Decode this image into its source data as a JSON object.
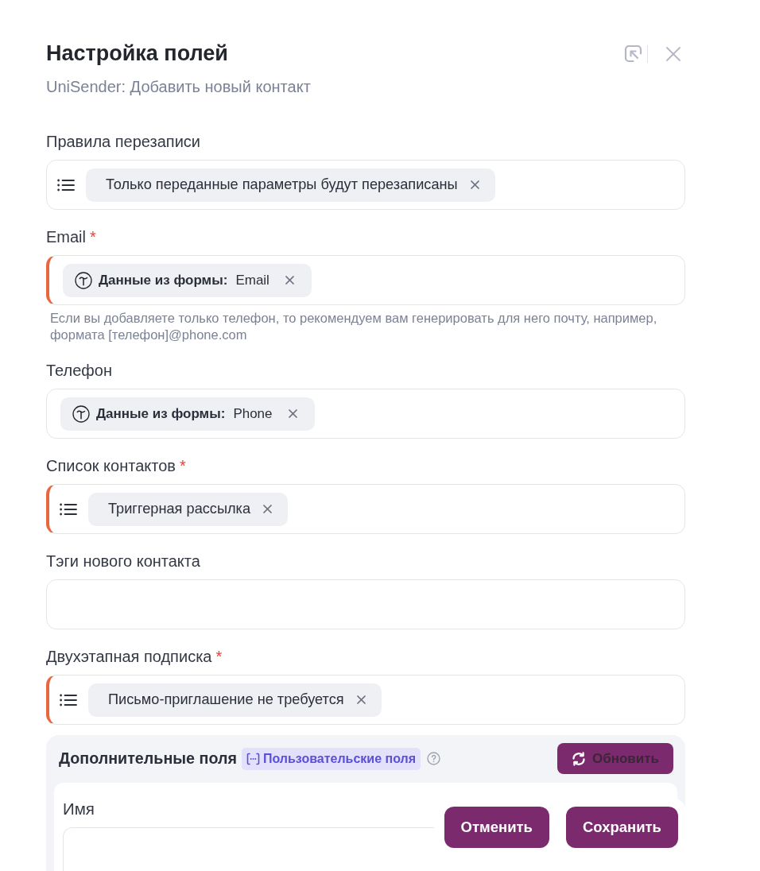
{
  "header": {
    "title": "Настройка полей",
    "subtitle": "UniSender: Добавить новый контакт"
  },
  "fields": [
    {
      "kind": "select",
      "label": "Правила перезаписи",
      "required": false,
      "chips": [
        {
          "text": "Только переданные параметры будут перезаписаны"
        }
      ]
    },
    {
      "kind": "mapping",
      "label": "Email",
      "required": true,
      "required_mark": "*",
      "chips": [
        {
          "source": "Данные из формы:",
          "value": "Email"
        }
      ],
      "hint": "Если вы добавляете только телефон, то рекомендуем вам генерировать для него почту, например, формата [телефон]@phone.com"
    },
    {
      "kind": "mapping",
      "label": "Телефон",
      "required": false,
      "chips": [
        {
          "source": "Данные из формы:",
          "value": "Phone"
        }
      ]
    },
    {
      "kind": "select",
      "label": "Список контактов",
      "required": true,
      "required_mark": "*",
      "chips": [
        {
          "text": "Триггерная рассылка"
        }
      ]
    },
    {
      "kind": "text",
      "label": "Тэги нового контакта",
      "required": false
    },
    {
      "kind": "select",
      "label": "Двухэтапная подписка",
      "required": true,
      "required_mark": "*",
      "chips": [
        {
          "text": "Письмо-приглашение не требуется"
        }
      ]
    }
  ],
  "extra_fields": {
    "title": "Дополнительные поля",
    "badge": "Пользовательские поля",
    "refresh_button": "Обновить",
    "fields": [
      {
        "label": "Имя"
      }
    ]
  },
  "footer": {
    "buttons": [
      {
        "label": "Отменить"
      },
      {
        "label": "Сохранить"
      }
    ]
  }
}
